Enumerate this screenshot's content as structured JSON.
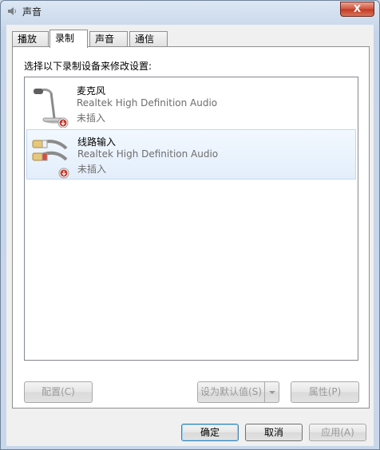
{
  "window": {
    "title": "声音",
    "close_label": "X"
  },
  "tabs": [
    {
      "label": "播放",
      "active": false
    },
    {
      "label": "录制",
      "active": true
    },
    {
      "label": "声音",
      "active": false
    },
    {
      "label": "通信",
      "active": false
    }
  ],
  "panel": {
    "instruction": "选择以下录制设备来修改设置:"
  },
  "devices": [
    {
      "name": "麦克风",
      "driver": "Realtek High Definition Audio",
      "status": "未插入",
      "icon": "microphone-icon"
    },
    {
      "name": "线路输入",
      "driver": "Realtek High Definition Audio",
      "status": "未插入",
      "icon": "line-in-cable-icon",
      "selected": true
    }
  ],
  "panel_buttons": {
    "configure": "配置(C)",
    "set_default": "设为默认值(S)",
    "properties": "属性(P)"
  },
  "footer_buttons": {
    "ok": "确定",
    "cancel": "取消",
    "apply": "应用(A)"
  },
  "colors": {
    "accent": "#3c7fb1",
    "disabled_text": "#9a9a9a",
    "close": "#c13a21"
  }
}
